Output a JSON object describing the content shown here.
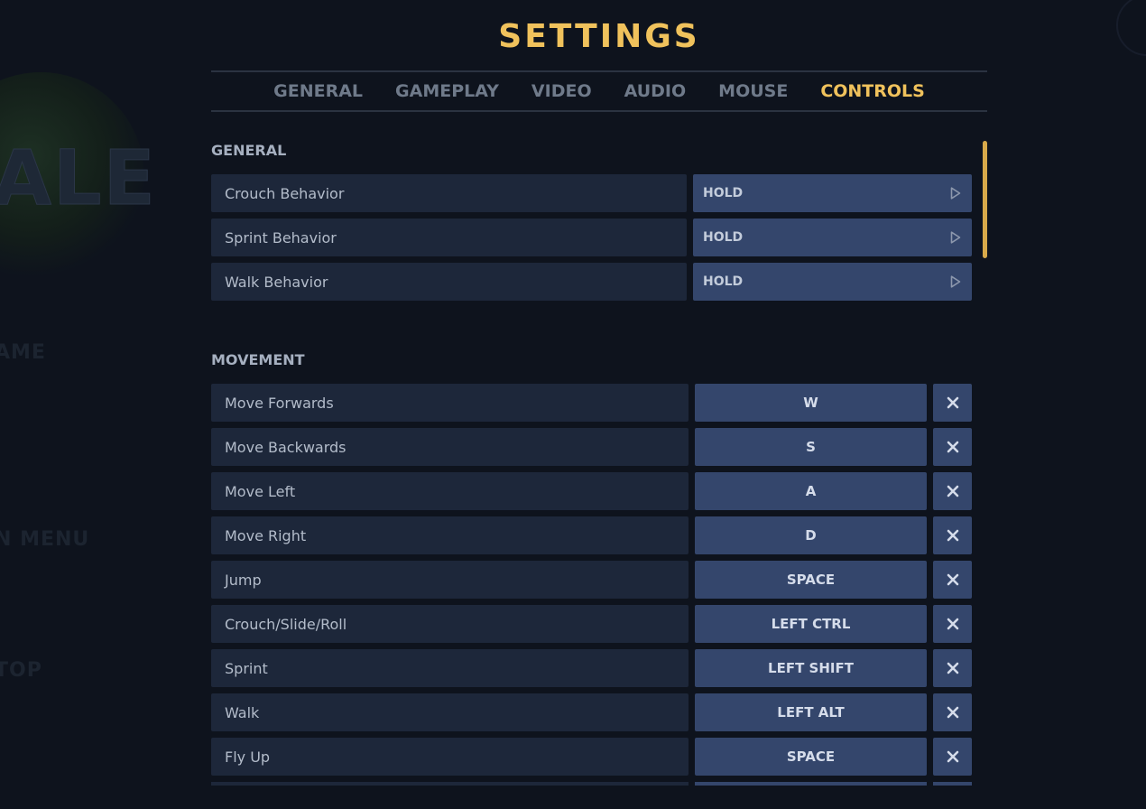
{
  "background": {
    "logo_text": "ALE",
    "menu_items": [
      "AME",
      "N MENU",
      "TOP"
    ]
  },
  "settings": {
    "title": "SETTINGS",
    "tabs": [
      "GENERAL",
      "GAMEPLAY",
      "VIDEO",
      "AUDIO",
      "MOUSE",
      "CONTROLS"
    ],
    "active_tab": "CONTROLS"
  },
  "colors": {
    "accent": "#f0c25c",
    "background": "#0e131d",
    "row_bg": "#1d273a",
    "control_bg": "#34466c"
  },
  "sections": {
    "general": {
      "title": "GENERAL",
      "rows": [
        {
          "label": "Crouch Behavior",
          "value": "HOLD"
        },
        {
          "label": "Sprint Behavior",
          "value": "HOLD"
        },
        {
          "label": "Walk Behavior",
          "value": "HOLD"
        }
      ]
    },
    "movement": {
      "title": "MOVEMENT",
      "rows": [
        {
          "label": "Move Forwards",
          "key": "W"
        },
        {
          "label": "Move Backwards",
          "key": "S"
        },
        {
          "label": "Move Left",
          "key": "A"
        },
        {
          "label": "Move Right",
          "key": "D"
        },
        {
          "label": "Jump",
          "key": "SPACE"
        },
        {
          "label": "Crouch/Slide/Roll",
          "key": "LEFT CTRL"
        },
        {
          "label": "Sprint",
          "key": "LEFT SHIFT"
        },
        {
          "label": "Walk",
          "key": "LEFT ALT"
        },
        {
          "label": "Fly Up",
          "key": "SPACE"
        }
      ]
    }
  },
  "icons": {
    "select_arrow": "play-triangle-outline",
    "clear_binding": "x-close"
  }
}
